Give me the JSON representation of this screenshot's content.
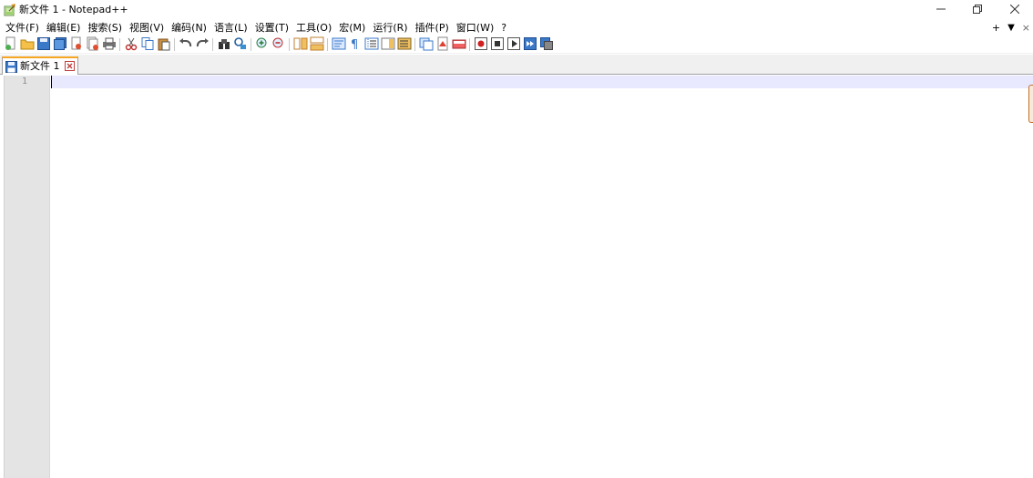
{
  "window": {
    "title": "新文件 1 - Notepad++",
    "icon": "notepad-plus-plus-icon",
    "controls": [
      "minimize-icon",
      "restore-icon",
      "close-icon"
    ]
  },
  "menu": {
    "items": [
      {
        "label": "文件(F)"
      },
      {
        "label": "编辑(E)"
      },
      {
        "label": "搜索(S)"
      },
      {
        "label": "视图(V)"
      },
      {
        "label": "编码(N)"
      },
      {
        "label": "语言(L)"
      },
      {
        "label": "设置(T)"
      },
      {
        "label": "工具(O)"
      },
      {
        "label": "宏(M)"
      },
      {
        "label": "运行(R)"
      },
      {
        "label": "插件(P)"
      },
      {
        "label": "窗口(W)"
      },
      {
        "label": "?"
      }
    ],
    "right": {
      "plus": "+",
      "dropdown": "▼",
      "close": "×"
    }
  },
  "toolbar": {
    "buttons": [
      "new-file",
      "open-file",
      "save",
      "save-all",
      "close",
      "close-all",
      "print",
      "cut",
      "copy",
      "paste",
      "undo",
      "redo",
      "find",
      "replace",
      "zoom-in",
      "zoom-out",
      "sync-vertical",
      "sync-horizontal",
      "word-wrap",
      "show-all-chars",
      "indent-guide",
      "doc-map",
      "function-list",
      "folder-as-workspace",
      "monitoring",
      "document-list",
      "start-recording",
      "stop-recording",
      "play-macro",
      "run-macro-multiple",
      "save-macro"
    ]
  },
  "tabs": [
    {
      "label": "新文件 1",
      "icon": "floppy-save-icon",
      "active": true
    }
  ],
  "editor": {
    "line_numbers": [
      "1"
    ],
    "content": "",
    "current_line_color": "#e8e8ff"
  },
  "colors": {
    "tab_accent": "#f5a623",
    "gutter": "#e4e4e4"
  }
}
